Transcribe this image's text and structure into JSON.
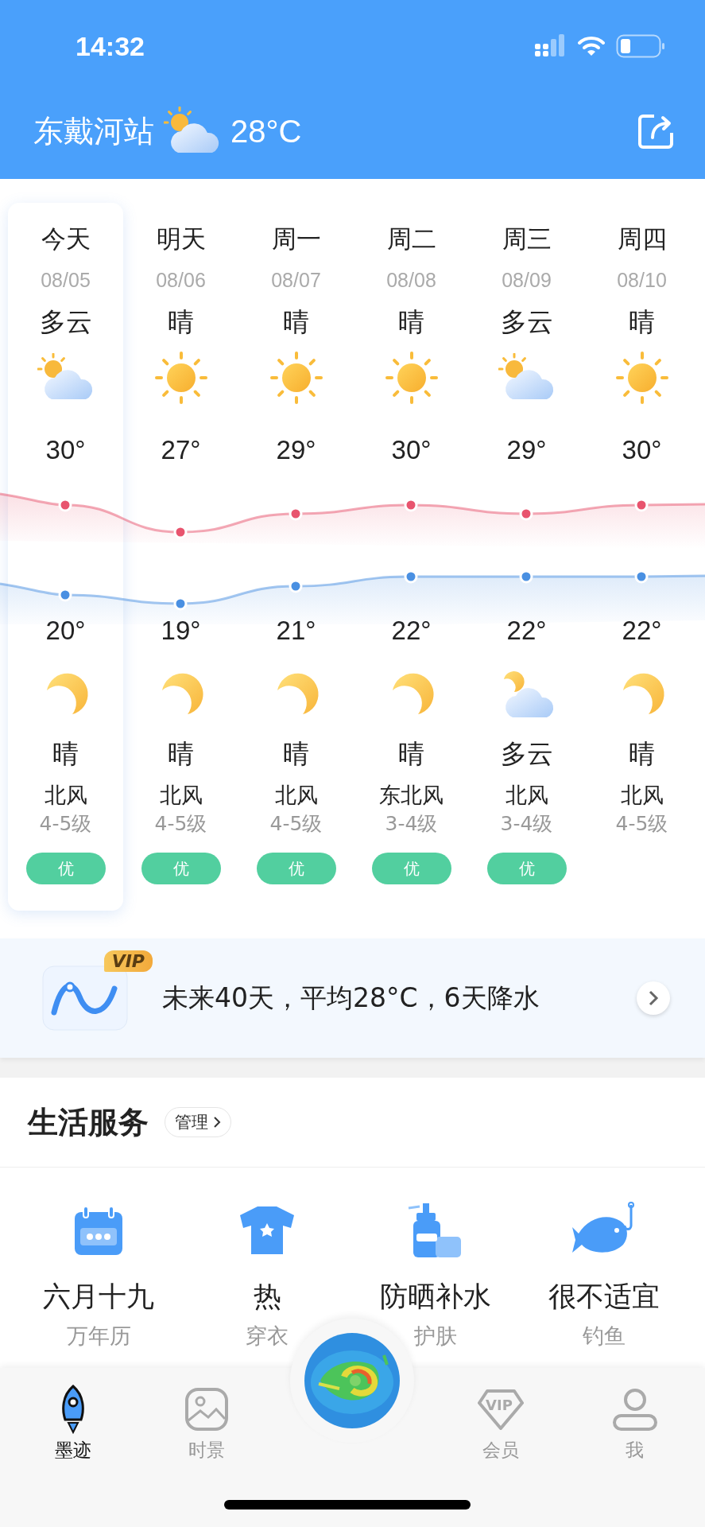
{
  "status_bar": {
    "time": "14:32"
  },
  "header": {
    "station": "东戴河站",
    "kind": "cloudy",
    "temperature": "28°C"
  },
  "forecast": {
    "days": [
      {
        "name": "今天",
        "date": "08/05",
        "selected": true,
        "day": {
          "condition": "多云",
          "kind": "cloudy"
        },
        "high": "30°",
        "low": "20°",
        "night": {
          "condition": "晴",
          "kind": "moon"
        },
        "wind": "北风",
        "level": "4-5级",
        "aqi": "优"
      },
      {
        "name": "明天",
        "date": "08/06",
        "selected": false,
        "day": {
          "condition": "晴",
          "kind": "sunny"
        },
        "high": "27°",
        "low": "19°",
        "night": {
          "condition": "晴",
          "kind": "moon"
        },
        "wind": "北风",
        "level": "4-5级",
        "aqi": "优"
      },
      {
        "name": "周一",
        "date": "08/07",
        "selected": false,
        "day": {
          "condition": "晴",
          "kind": "sunny"
        },
        "high": "29°",
        "low": "21°",
        "night": {
          "condition": "晴",
          "kind": "moon"
        },
        "wind": "北风",
        "level": "4-5级",
        "aqi": "优"
      },
      {
        "name": "周二",
        "date": "08/08",
        "selected": false,
        "day": {
          "condition": "晴",
          "kind": "sunny"
        },
        "high": "30°",
        "low": "22°",
        "night": {
          "condition": "晴",
          "kind": "moon"
        },
        "wind": "东北风",
        "level": "3-4级",
        "aqi": "优"
      },
      {
        "name": "周三",
        "date": "08/09",
        "selected": false,
        "day": {
          "condition": "多云",
          "kind": "cloudy"
        },
        "high": "29°",
        "low": "22°",
        "night": {
          "condition": "多云",
          "kind": "cloudymoon"
        },
        "wind": "北风",
        "level": "3-4级",
        "aqi": "优"
      },
      {
        "name": "周四",
        "date": "08/10",
        "selected": false,
        "day": {
          "condition": "晴",
          "kind": "sunny"
        },
        "high": "30°",
        "low": "22°",
        "night": {
          "condition": "晴",
          "kind": "moon"
        },
        "wind": "北风",
        "level": "4-5级"
      }
    ]
  },
  "vip_banner": {
    "badge": "VIP",
    "text": "未来40天，平均28°C，6天降水"
  },
  "services": {
    "title": "生活服务",
    "manage": "管理",
    "items": [
      {
        "value": "六月十九",
        "label": "万年历"
      },
      {
        "value": "热",
        "label": "穿衣"
      },
      {
        "value": "防晒补水",
        "label": "护肤"
      },
      {
        "value": "很不适宜",
        "label": "钓鱼"
      }
    ]
  },
  "tabs": [
    {
      "label": "墨迹",
      "selected": true
    },
    {
      "label": "时景",
      "selected": false
    },
    {
      "kind": "picture"
    },
    {
      "label": "会员",
      "selected": false,
      "badge": "VIP"
    },
    {
      "label": "我",
      "selected": false
    }
  ]
}
